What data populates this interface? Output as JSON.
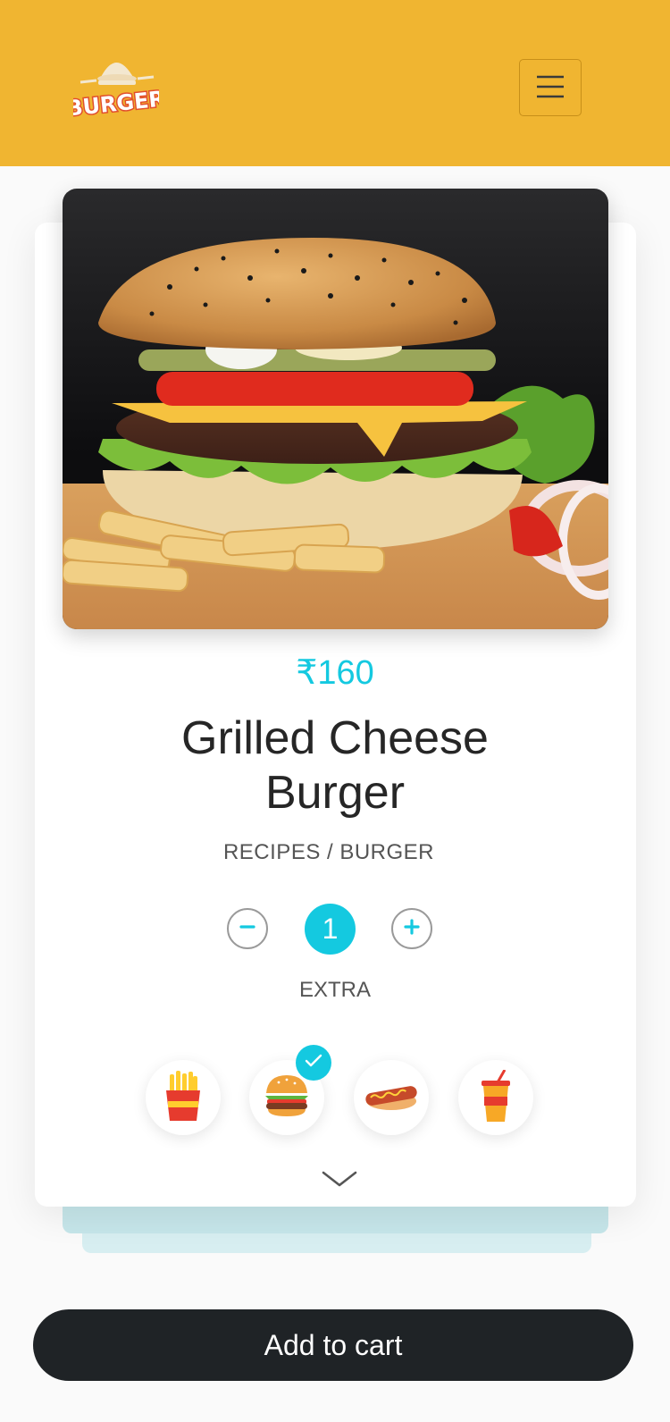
{
  "header": {
    "logo_text": "BURGER",
    "menu_icon": "hamburger-menu-icon"
  },
  "product": {
    "image_subject": "cheeseburger with fries",
    "price": "₹160",
    "title": "Grilled Cheese Burger",
    "breadcrumb": "RECIPES / BURGER"
  },
  "quantity": {
    "value": "1",
    "minus_icon": "minus-icon",
    "plus_icon": "plus-icon"
  },
  "extras": {
    "label": "EXTRA",
    "items": [
      {
        "icon": "fries-icon",
        "selected": false
      },
      {
        "icon": "burger-icon",
        "selected": true
      },
      {
        "icon": "hotdog-icon",
        "selected": false
      },
      {
        "icon": "soda-cup-icon",
        "selected": false
      }
    ]
  },
  "cart": {
    "button_label": "Add to cart"
  },
  "colors": {
    "header_bg": "#f0b531",
    "accent": "#14c9e0",
    "button_bg": "#1f2326"
  }
}
